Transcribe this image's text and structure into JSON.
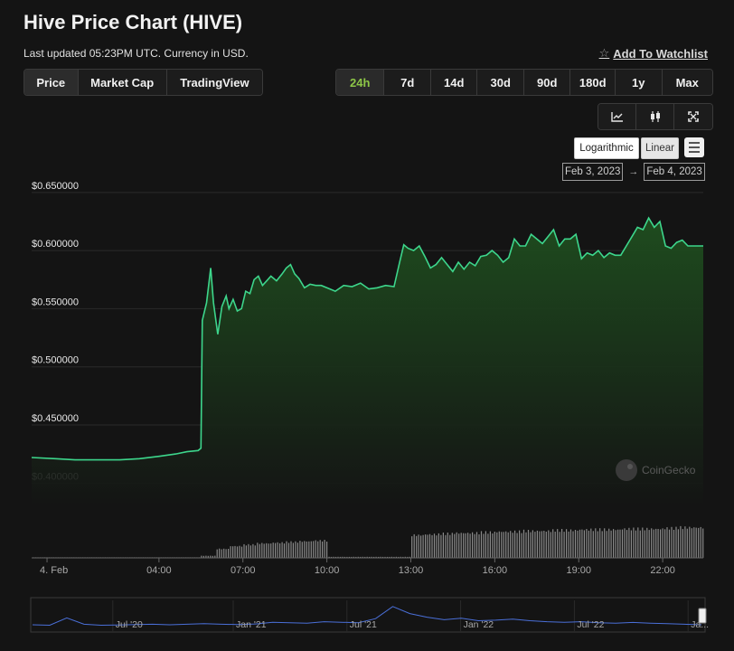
{
  "header": {
    "title": "Hive Price Chart (HIVE)",
    "subtitle": "Last updated 05:23PM UTC. Currency in USD.",
    "watchlist_label": "Add To Watchlist"
  },
  "chart_tabs": [
    "Price",
    "Market Cap",
    "TradingView"
  ],
  "time_ranges": [
    "24h",
    "7d",
    "14d",
    "30d",
    "90d",
    "180d",
    "1y",
    "Max"
  ],
  "selected_range": "24h",
  "chart_type_icons": [
    "line-chart-icon",
    "candlestick-icon",
    "fullscreen-icon"
  ],
  "scale": {
    "log_label": "Logarithmic",
    "linear_label": "Linear",
    "selected": "Linear"
  },
  "date_range": {
    "from": "Feb 3, 2023",
    "arrow": "→",
    "to": "Feb 4, 2023"
  },
  "watermark": "CoinGecko",
  "colors": {
    "accent_active": "#8dc647",
    "price_line": "#3dd68c",
    "navigator_line": "#4a6fd8",
    "background": "#141414"
  },
  "chart_data": {
    "type": "area",
    "title": "",
    "ylim": [
      0.38,
      0.66
    ],
    "y_ticks": [
      "$0.650000",
      "$0.600000",
      "$0.550000",
      "$0.500000",
      "$0.450000",
      "$0.400000"
    ],
    "y_tick_values": [
      0.65,
      0.6,
      0.55,
      0.5,
      0.45,
      0.4
    ],
    "x_ticks": [
      "4. Feb",
      "04:00",
      "07:00",
      "10:00",
      "13:00",
      "16:00",
      "19:00",
      "22:00"
    ],
    "x_tick_hours": [
      0,
      4,
      7,
      10,
      13,
      16,
      19,
      22
    ],
    "x_range_hours": [
      -0.55,
      23.45
    ],
    "grid": true,
    "series": [
      {
        "x": [
          -0.55,
          0.3,
          1.0,
          1.8,
          2.6,
          3.3,
          4.0,
          4.6,
          5.0,
          5.4,
          5.5,
          5.55,
          5.7,
          5.85,
          5.95,
          6.1,
          6.25,
          6.4,
          6.5,
          6.65,
          6.8,
          6.95,
          7.1,
          7.25,
          7.4,
          7.55,
          7.7,
          7.85,
          8.0,
          8.2,
          8.4,
          8.55,
          8.7,
          8.85,
          9.0,
          9.2,
          9.4,
          9.6,
          9.8,
          10.0,
          10.3,
          10.6,
          10.9,
          11.2,
          11.5,
          11.8,
          12.1,
          12.4,
          12.6,
          12.75,
          12.9,
          13.1,
          13.3,
          13.5,
          13.7,
          13.9,
          14.1,
          14.3,
          14.5,
          14.7,
          14.9,
          15.1,
          15.3,
          15.5,
          15.7,
          15.9,
          16.1,
          16.3,
          16.5,
          16.7,
          16.9,
          17.1,
          17.3,
          17.5,
          17.7,
          17.9,
          18.1,
          18.3,
          18.5,
          18.7,
          18.9,
          19.1,
          19.3,
          19.5,
          19.7,
          19.9,
          20.1,
          20.3,
          20.5,
          20.7,
          20.9,
          21.1,
          21.3,
          21.5,
          21.7,
          21.9,
          22.1,
          22.3,
          22.5,
          22.7,
          22.9,
          23.1,
          23.3,
          23.45
        ],
        "y": [
          0.422,
          0.421,
          0.42,
          0.42,
          0.42,
          0.421,
          0.423,
          0.425,
          0.427,
          0.428,
          0.43,
          0.54,
          0.555,
          0.585,
          0.555,
          0.528,
          0.552,
          0.561,
          0.55,
          0.558,
          0.548,
          0.55,
          0.565,
          0.563,
          0.575,
          0.578,
          0.57,
          0.574,
          0.578,
          0.574,
          0.58,
          0.585,
          0.588,
          0.58,
          0.576,
          0.568,
          0.571,
          0.57,
          0.57,
          0.568,
          0.565,
          0.57,
          0.569,
          0.572,
          0.567,
          0.568,
          0.57,
          0.569,
          0.59,
          0.605,
          0.602,
          0.6,
          0.604,
          0.595,
          0.585,
          0.588,
          0.594,
          0.588,
          0.582,
          0.59,
          0.584,
          0.59,
          0.587,
          0.595,
          0.596,
          0.6,
          0.596,
          0.59,
          0.594,
          0.61,
          0.604,
          0.604,
          0.614,
          0.61,
          0.606,
          0.612,
          0.618,
          0.604,
          0.61,
          0.61,
          0.614,
          0.593,
          0.598,
          0.596,
          0.6,
          0.594,
          0.598,
          0.596,
          0.596,
          0.604,
          0.612,
          0.62,
          0.618,
          0.628,
          0.62,
          0.625,
          0.604,
          0.602,
          0.607,
          0.609,
          0.604,
          0.604,
          0.604,
          0.604
        ]
      }
    ],
    "volume": {
      "x": [
        0.0,
        1.0,
        2.0,
        3.0,
        4.0,
        5.0,
        5.5,
        6.0,
        6.5,
        7.0,
        7.5,
        8.0,
        8.5,
        9.0,
        9.5,
        10.0,
        10.5,
        11.0,
        11.5,
        12.0,
        12.5,
        13.0,
        13.5,
        14.0,
        14.5,
        15.0,
        15.5,
        16.0,
        16.5,
        17.0,
        17.5,
        18.0,
        18.5,
        19.0,
        19.5,
        20.0,
        20.5,
        21.0,
        21.5,
        22.0,
        22.5,
        23.0
      ],
      "y": [
        0.01,
        0.01,
        0.01,
        0.01,
        0.01,
        0.01,
        0.06,
        0.26,
        0.34,
        0.38,
        0.42,
        0.44,
        0.46,
        0.48,
        0.5,
        0.03,
        0.03,
        0.03,
        0.03,
        0.03,
        0.03,
        0.66,
        0.68,
        0.7,
        0.72,
        0.72,
        0.74,
        0.76,
        0.76,
        0.78,
        0.78,
        0.8,
        0.8,
        0.82,
        0.82,
        0.82,
        0.84,
        0.84,
        0.84,
        0.86,
        0.88,
        0.88
      ]
    },
    "navigator": {
      "x_ticks": [
        "Jul '20",
        "Jan '21",
        "Jul '21",
        "Jan '22",
        "Jul '22",
        "Ja..."
      ],
      "x_tick_fracs": [
        0.12,
        0.3,
        0.47,
        0.64,
        0.81,
        0.98
      ],
      "y": [
        0.18,
        0.16,
        0.45,
        0.2,
        0.16,
        0.17,
        0.19,
        0.2,
        0.18,
        0.2,
        0.22,
        0.2,
        0.19,
        0.21,
        0.28,
        0.26,
        0.24,
        0.3,
        0.28,
        0.26,
        0.42,
        0.9,
        0.62,
        0.48,
        0.38,
        0.44,
        0.34,
        0.36,
        0.4,
        0.34,
        0.3,
        0.28,
        0.3,
        0.26,
        0.24,
        0.27,
        0.24,
        0.22,
        0.2,
        0.18
      ]
    }
  }
}
